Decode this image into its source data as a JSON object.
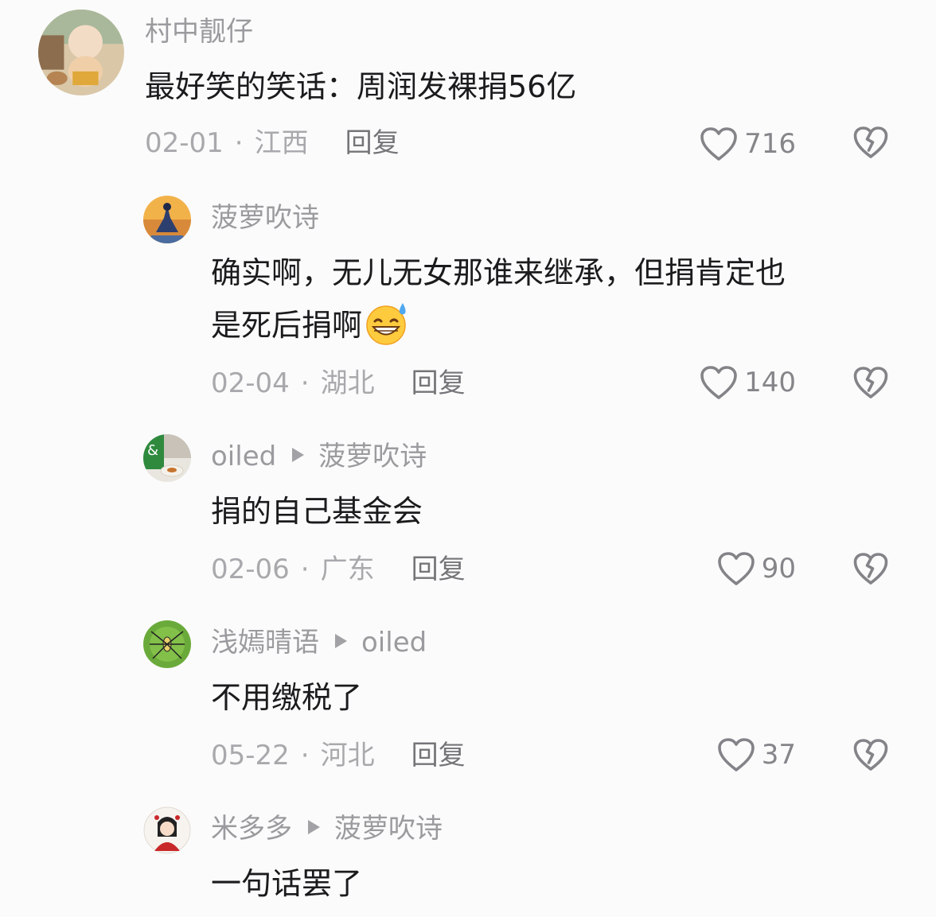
{
  "comments": [
    {
      "author": "村中靓仔",
      "text": "最好笑的笑话：周润发裸捐56亿",
      "date": "02-01",
      "location": "江西",
      "reply_label": "回复",
      "likes": "716"
    },
    {
      "author": "菠萝吹诗",
      "text_line1": "确实啊，无儿无女那谁来继承，但捐肯定也",
      "text_line2": "是死后捐啊",
      "emoji": "grinning-sweat-emoji",
      "date": "02-04",
      "location": "湖北",
      "reply_label": "回复",
      "likes": "140"
    },
    {
      "author": "oiled",
      "reply_to": "菠萝吹诗",
      "text": "捐的自己基金会",
      "date": "02-06",
      "location": "广东",
      "reply_label": "回复",
      "likes": "90"
    },
    {
      "author": "浅嫣晴语",
      "reply_to": "oiled",
      "text": "不用缴税了",
      "date": "05-22",
      "location": "河北",
      "reply_label": "回复",
      "likes": "37"
    },
    {
      "author": "米多多",
      "reply_to": "菠萝吹诗",
      "text": "一句话罢了"
    }
  ],
  "separator": "·",
  "icons": {
    "like": "heart-outline-icon",
    "dislike": "broken-heart-icon",
    "reply_arrow": "play-arrow-icon"
  },
  "colors": {
    "background": "#fbfbfb",
    "name": "#9b9b9f",
    "text": "#1b1b1d",
    "meta": "#a9a9ad"
  }
}
